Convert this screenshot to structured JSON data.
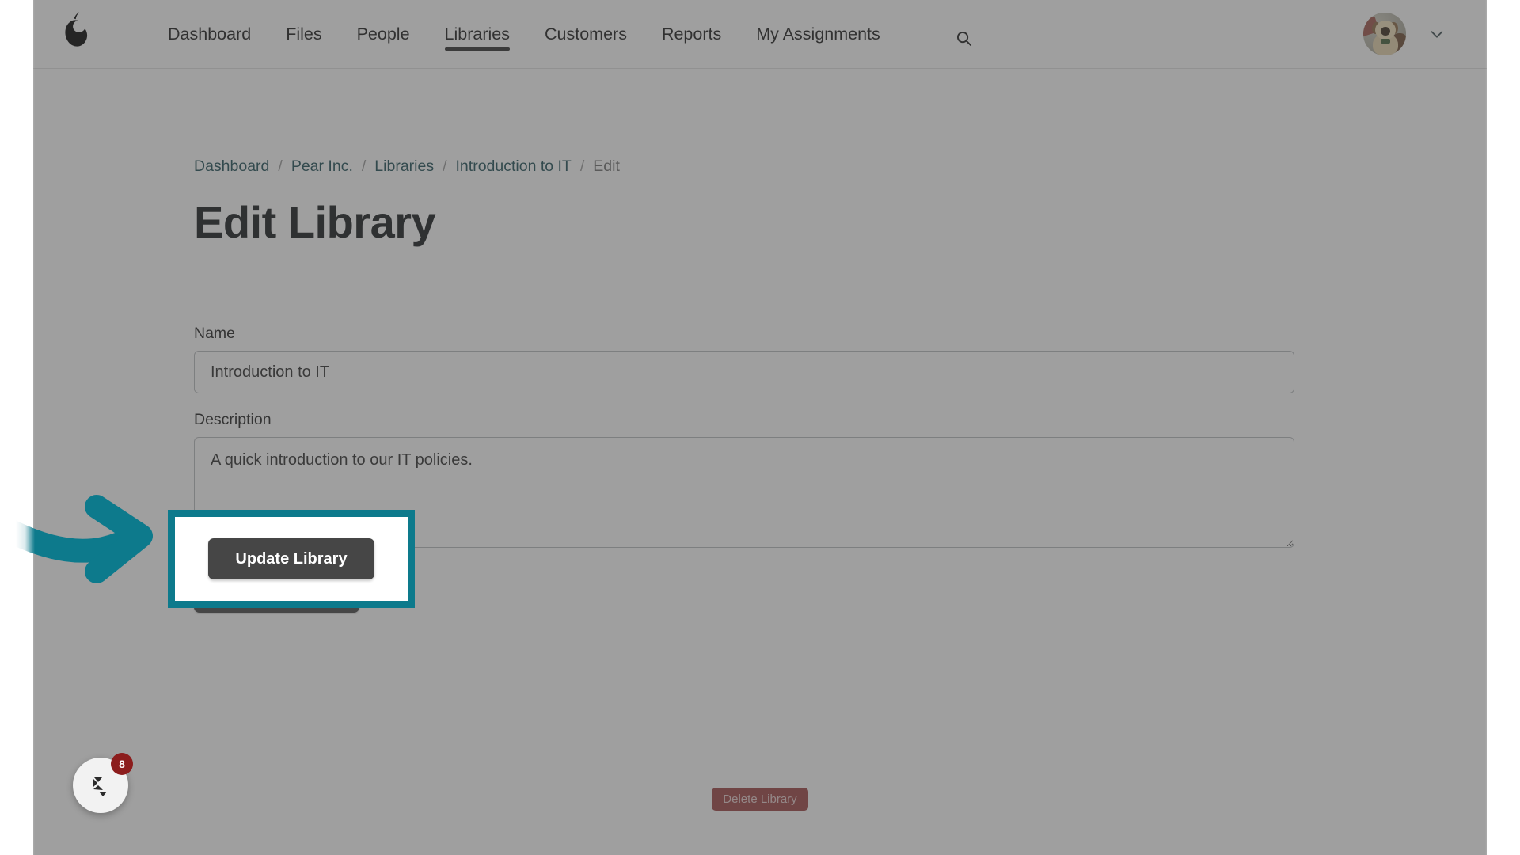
{
  "nav": {
    "logo_icon": "pear-logo-icon",
    "links": [
      {
        "label": "Dashboard",
        "active": false
      },
      {
        "label": "Files",
        "active": false
      },
      {
        "label": "People",
        "active": false
      },
      {
        "label": "Libraries",
        "active": true
      },
      {
        "label": "Customers",
        "active": false
      },
      {
        "label": "Reports",
        "active": false
      },
      {
        "label": "My Assignments",
        "active": false
      }
    ],
    "search_icon": "search-icon",
    "avatar_alt": "User avatar",
    "chevron_icon": "chevron-down-icon"
  },
  "breadcrumb": {
    "items": [
      {
        "label": "Dashboard",
        "current": false
      },
      {
        "label": "Pear Inc.",
        "current": false
      },
      {
        "label": "Libraries",
        "current": false
      },
      {
        "label": "Introduction to IT",
        "current": false
      },
      {
        "label": "Edit",
        "current": true
      }
    ],
    "separator": "/"
  },
  "page": {
    "title": "Edit Library"
  },
  "form": {
    "name": {
      "label": "Name",
      "value": "Introduction to IT",
      "placeholder": ""
    },
    "description": {
      "label": "Description",
      "value": "A quick introduction to our IT policies.",
      "placeholder": ""
    },
    "submit_label": "Update Library"
  },
  "danger_zone": {
    "delete_label": "Delete Library"
  },
  "support_widget": {
    "icon": "chat-logo-icon",
    "badge_count": "8"
  },
  "annotation": {
    "highlight_label": "Update Library",
    "highlight_color": "#0d7a8c",
    "arrow_icon": "curved-arrow-right-icon"
  },
  "colors": {
    "accent_teal": "#0d7a8c",
    "link_teal": "#1f4f57",
    "button_dark": "#464646",
    "danger_red": "#9e4343",
    "badge_red": "#8c1d1d"
  }
}
